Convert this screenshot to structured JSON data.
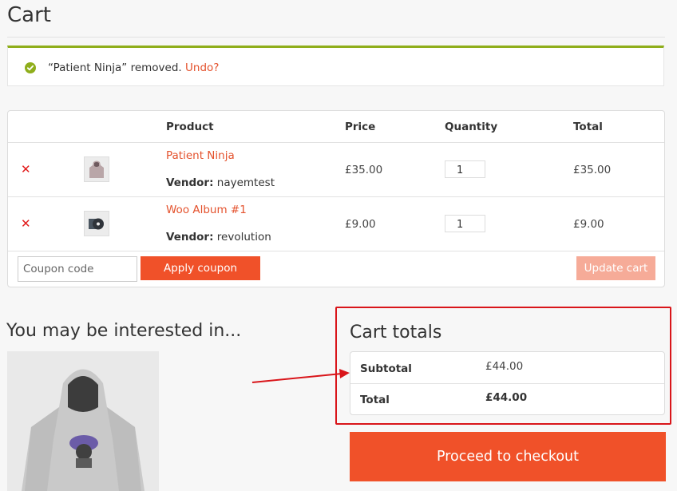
{
  "page": {
    "title": "Cart"
  },
  "notice": {
    "message": "“Patient Ninja” removed.",
    "undo_label": "Undo?",
    "icon": "check-circle-icon",
    "accent_color": "#8fae1b"
  },
  "cart": {
    "headers": {
      "product": "Product",
      "price": "Price",
      "quantity": "Quantity",
      "total": "Total"
    },
    "items": [
      {
        "name": "Patient Ninja",
        "vendor_label": "Vendor:",
        "vendor": "nayemtest",
        "price": "£35.00",
        "quantity": "1",
        "total": "£35.00",
        "thumbnail": "hoodie-thumbnail"
      },
      {
        "name": "Woo Album #1",
        "vendor_label": "Vendor:",
        "vendor": "revolution",
        "price": "£9.00",
        "quantity": "1",
        "total": "£9.00",
        "thumbnail": "album-cd-thumbnail"
      }
    ],
    "coupon_placeholder": "Coupon code",
    "apply_coupon_label": "Apply coupon",
    "update_cart_label": "Update cart"
  },
  "interest": {
    "title": "You may be interested in..."
  },
  "totals": {
    "title": "Cart totals",
    "subtotal_label": "Subtotal",
    "subtotal_value": "£44.00",
    "total_label": "Total",
    "total_value": "£44.00"
  },
  "checkout": {
    "label": "Proceed to checkout"
  },
  "colors": {
    "brand": "#f05129",
    "link": "#e4522d",
    "remove": "#e21b1b",
    "annotation": "#d9151a"
  }
}
